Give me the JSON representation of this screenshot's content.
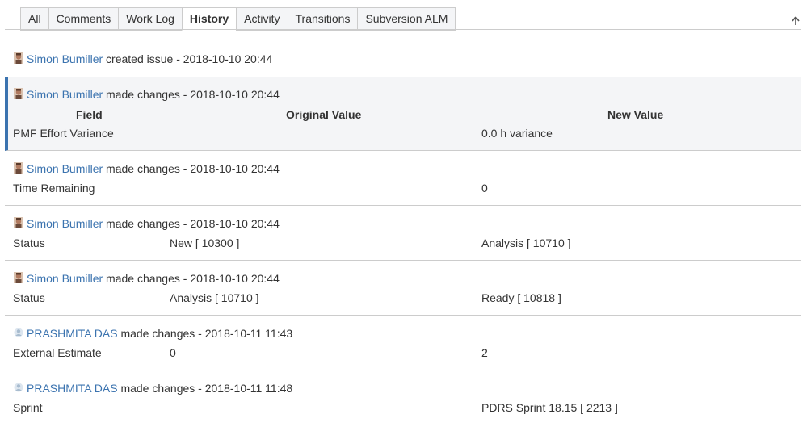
{
  "tabs": [
    {
      "label": "All"
    },
    {
      "label": "Comments"
    },
    {
      "label": "Work Log"
    },
    {
      "label": "History",
      "active": true
    },
    {
      "label": "Activity"
    },
    {
      "label": "Transitions"
    },
    {
      "label": "Subversion ALM"
    }
  ],
  "scroll_top_icon": "arrow-up-icon",
  "table_headers": {
    "field": "Field",
    "original": "Original Value",
    "new": "New Value"
  },
  "entries": [
    {
      "user": "Simon Bumiller",
      "avatar": "person-avatar-icon",
      "action": "created issue - 2018-10-10 20:44"
    },
    {
      "user": "Simon Bumiller",
      "avatar": "person-avatar-icon",
      "action": "made changes - 2018-10-10 20:44",
      "field": "PMF Effort Variance",
      "original": "",
      "new": "0.0 h variance"
    },
    {
      "user": "Simon Bumiller",
      "avatar": "person-avatar-icon",
      "action": "made changes - 2018-10-10 20:44",
      "field": "Time Remaining",
      "original": "",
      "new": "0"
    },
    {
      "user": "Simon Bumiller",
      "avatar": "person-avatar-icon",
      "action": "made changes - 2018-10-10 20:44",
      "field": "Status",
      "original": "New [ 10300 ]",
      "new": "Analysis [ 10710 ]"
    },
    {
      "user": "Simon Bumiller",
      "avatar": "person-avatar-icon",
      "action": "made changes - 2018-10-10 20:44",
      "field": "Status",
      "original": "Analysis [ 10710 ]",
      "new": "Ready [ 10818 ]"
    },
    {
      "user": "PRASHMITA DAS",
      "avatar": "default-avatar-icon",
      "action": "made changes - 2018-10-11 11:43",
      "field": "External Estimate",
      "original": "0",
      "new": "2"
    },
    {
      "user": "PRASHMITA DAS",
      "avatar": "default-avatar-icon",
      "action": "made changes - 2018-10-11 11:48",
      "field": "Sprint",
      "original": "",
      "new": "PDRS Sprint 18.15 [ 2213 ]"
    }
  ]
}
